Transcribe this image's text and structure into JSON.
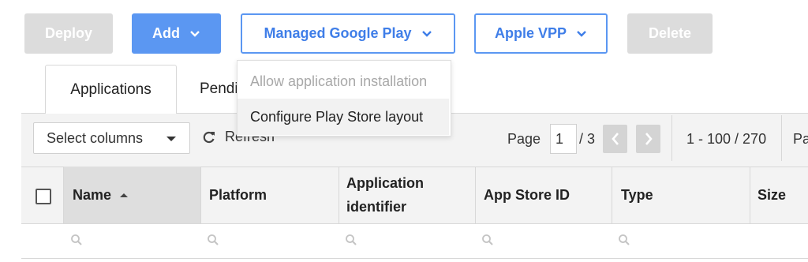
{
  "toolbar": {
    "deploy_label": "Deploy",
    "add_label": "Add",
    "managed_google_play_label": "Managed Google Play",
    "apple_vpp_label": "Apple VPP",
    "delete_label": "Delete"
  },
  "tabs": [
    {
      "label": "Applications"
    },
    {
      "label": "Pendi"
    }
  ],
  "dropdown": {
    "items": [
      {
        "label": "Allow application installation"
      },
      {
        "label": "Configure Play Store layout"
      }
    ]
  },
  "grid_toolbar": {
    "select_columns": "Select columns",
    "refresh": "Refresh",
    "page_label": "Page",
    "page_value": "1",
    "page_total": "/ 3",
    "range": "1 - 100 / 270",
    "trailing": "Pa"
  },
  "columns": [
    {
      "label": "Name"
    },
    {
      "label": "Platform"
    },
    {
      "label": "Application identifier"
    },
    {
      "label": "App Store ID"
    },
    {
      "label": "Type"
    },
    {
      "label": "Size"
    }
  ],
  "colors": {
    "primary": "#5b97f2",
    "disabled": "#dcdcdc"
  }
}
